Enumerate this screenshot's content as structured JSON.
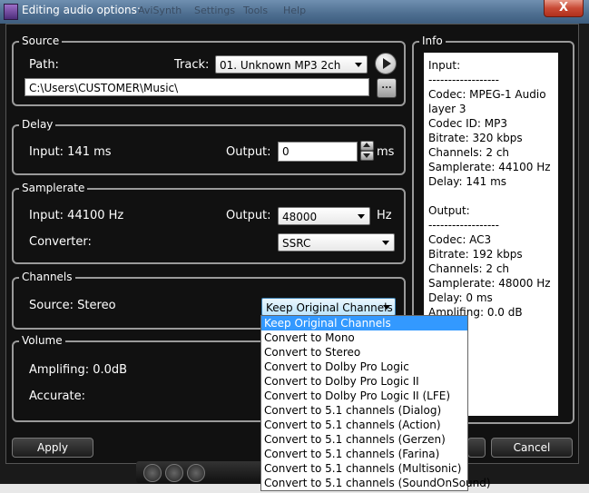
{
  "window": {
    "title": "Editing audio options:",
    "bg_menus": [
      "AviSynth",
      "Settings",
      "Tools",
      "Help"
    ],
    "close_label": "X"
  },
  "source": {
    "group_title": "Source",
    "path_label": "Path:",
    "track_label": "Track:",
    "track_value": "01. Unknown MP3 2ch",
    "path_value": "C:\\Users\\CUSTOMER\\Music\\",
    "browse_label": "..."
  },
  "delay": {
    "group_title": "Delay",
    "input_label": "Input: 141 ms",
    "output_label": "Output:",
    "output_value": "0",
    "unit": "ms"
  },
  "samplerate": {
    "group_title": "Samplerate",
    "input_label": "Input: 44100 Hz",
    "output_label": "Output:",
    "output_value": "48000",
    "unit": "Hz",
    "converter_label": "Converter:",
    "converter_value": "SSRC"
  },
  "channels": {
    "group_title": "Channels",
    "source_label": "Source: Stereo",
    "selected": "Keep Original Channels",
    "options": [
      "Keep Original Channels",
      "Convert to Mono",
      "Convert to Stereo",
      "Convert to Dolby Pro Logic",
      "Convert to Dolby Pro Logic II",
      "Convert to Dolby Pro Logic II (LFE)",
      "Convert to 5.1 channels (Dialog)",
      "Convert to 5.1 channels (Action)",
      "Convert to 5.1 channels (Gerzen)",
      "Convert to 5.1 channels (Farina)",
      "Convert to 5.1 channels (Multisonic)",
      "Convert to 5.1 channels (SoundOnSound)"
    ]
  },
  "volume": {
    "group_title": "Volume",
    "amplifing_label": "Amplifing: 0.0dB",
    "accurate_label": "Accurate:"
  },
  "info": {
    "group_title": "Info",
    "lines": [
      "Input:",
      "------------------",
      "Codec: MPEG-1 Audio",
      "layer 3",
      "Codec ID: MP3",
      "Bitrate: 320 kbps",
      "Channels: 2 ch",
      "Samplerate: 44100 Hz",
      "Delay: 141 ms",
      "",
      "Output:",
      "------------------",
      "Codec: AC3",
      "Bitrate: 192 kbps",
      "Channels: 2 ch",
      "Samplerate: 48000 Hz",
      "Delay: 0 ms",
      "Amplifing: 0.0 dB"
    ]
  },
  "buttons": {
    "apply": "Apply",
    "cancel": "Cancel"
  }
}
